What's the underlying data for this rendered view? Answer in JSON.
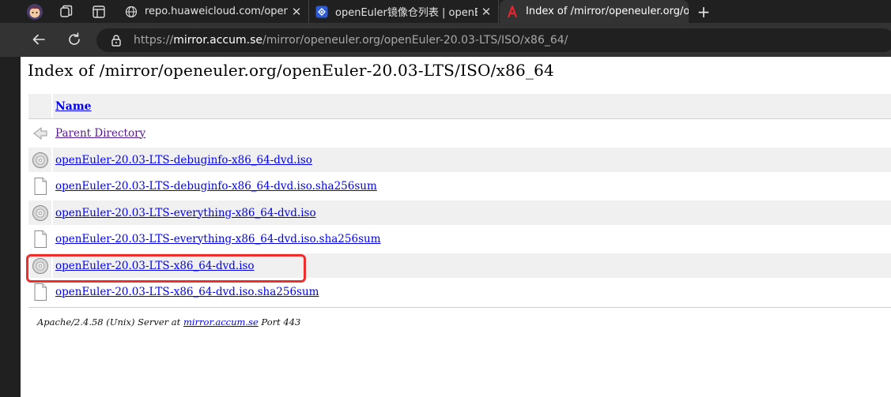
{
  "browser": {
    "tabs": [
      {
        "title": "repo.huaweicloud.com/openeuler",
        "favicon": "globe-icon",
        "active": false
      },
      {
        "title": "openEuler镜像仓列表 | openEuler",
        "favicon": "openeuler-logo-icon",
        "active": false
      },
      {
        "title": "Index of /mirror/openeuler.org/op",
        "favicon": "apache-feather-icon",
        "active": true
      }
    ],
    "new_tab_label": "+",
    "close_label": "✕",
    "url_scheme": "https://",
    "url_host": "mirror.accum.se",
    "url_path": "/mirror/openeuler.org/openEuler-20.03-LTS/ISO/x86_64/"
  },
  "page": {
    "heading": "Index of /mirror/openeuler.org/openEuler-20.03-LTS/ISO/x86_64",
    "column_header": "Name",
    "entries": [
      {
        "name": "Parent Directory",
        "icon": "back-arrow-icon",
        "type": "parent"
      },
      {
        "name": "openEuler-20.03-LTS-debuginfo-x86_64-dvd.iso",
        "icon": "cd-disc-icon",
        "type": "iso"
      },
      {
        "name": "openEuler-20.03-LTS-debuginfo-x86_64-dvd.iso.sha256sum",
        "icon": "text-file-icon",
        "type": "file"
      },
      {
        "name": "openEuler-20.03-LTS-everything-x86_64-dvd.iso",
        "icon": "cd-disc-icon",
        "type": "iso"
      },
      {
        "name": "openEuler-20.03-LTS-everything-x86_64-dvd.iso.sha256sum",
        "icon": "text-file-icon",
        "type": "file"
      },
      {
        "name": "openEuler-20.03-LTS-x86_64-dvd.iso",
        "icon": "cd-disc-icon",
        "type": "iso",
        "highlighted": true
      },
      {
        "name": "openEuler-20.03-LTS-x86_64-dvd.iso.sha256sum",
        "icon": "text-file-icon",
        "type": "file"
      }
    ],
    "footer": {
      "prefix": "Apache/2.4.58 (Unix) Server at ",
      "host": "mirror.accum.se",
      "suffix": " Port 443"
    }
  },
  "colors": {
    "highlight_border": "#ee2d2d",
    "link": "#0000ee",
    "visited_link": "#551a8b"
  }
}
